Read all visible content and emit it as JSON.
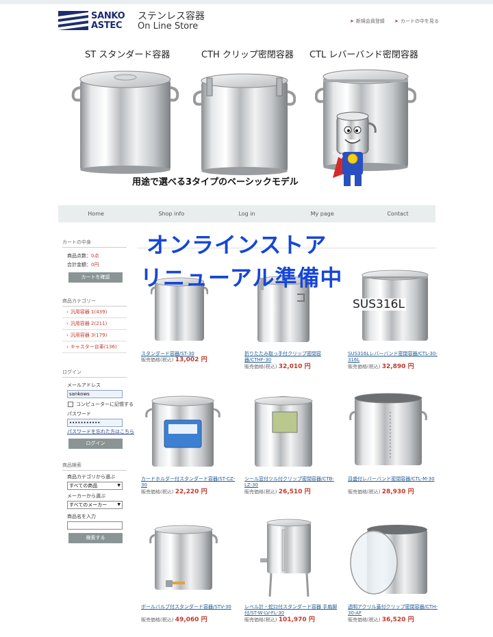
{
  "header": {
    "logo_line1": "SANKO",
    "logo_line2": "ASTEC",
    "logo_line3": "ステンレス容器",
    "logo_line4": "On Line Store",
    "register_link": "新規会員登録",
    "cart_link": "カートの中を見る"
  },
  "banner": {
    "caption_st": "ST スタンダード容器",
    "caption_cth": "CTH クリップ密閉容器",
    "caption_ctl": "CTL レバーバンド密閉容器",
    "tagline": "用途で選べる3タイプのベーシックモデル"
  },
  "nav": [
    "Home",
    "Shop info",
    "Log in",
    "My page",
    "Contact"
  ],
  "overlay": {
    "line1": "オンラインストア",
    "line2": "リニューアル準備中"
  },
  "sidebar": {
    "cart": {
      "heading": "カートの中身",
      "count_label": "商品点数：",
      "count_value": "0点",
      "total_label": "合計金額：",
      "total_value": "0円",
      "confirm_button": "カートを確認"
    },
    "categories": {
      "heading": "商品カテゴリー",
      "items": [
        "汎用容器 1(439)",
        "汎用容器 2(211)",
        "汎用容器 3(179)",
        "キャスター台車(136)"
      ]
    },
    "login": {
      "heading": "ログイン",
      "email_label": "メールアドレス",
      "email_value": "sankows",
      "remember_label": "コンピューターに記憶する",
      "password_label": "パスワード",
      "password_value": "•••••••••••",
      "forgot_link": "パスワードを忘れた方はこちら",
      "login_button": "ログイン"
    },
    "search": {
      "heading": "商品検索",
      "category_label": "商品カテゴリから選ぶ",
      "category_value": "すべての商品",
      "maker_label": "メーカーから選ぶ",
      "maker_value": "すべてのメーカー",
      "name_label": "商品名を入力",
      "search_button": "検索する"
    }
  },
  "products": [
    {
      "name": "スタンダード容器/ST-30",
      "price_label": "販売価格(税込)",
      "price": "13,002 円"
    },
    {
      "name": "折りたたみ取っ手付クリップ密閉容器/CTHF-30",
      "price_label": "販売価格(税込)",
      "price": "32,010 円"
    },
    {
      "name": "SUS316Lレバーバンド密閉容器/CTL-30-316L",
      "price_label": "販売価格(税込)",
      "price": "32,890 円",
      "image_label": "SUS316L"
    },
    {
      "name": "カードホルダー付スタンダード容器/ST-CZ-30",
      "price_label": "販売価格(税込)",
      "price": "22,220 円"
    },
    {
      "name": "シール窓付ツル付クリップ密閉容器/CTB-LZ-30",
      "price_label": "販売価格(税込)",
      "price": "26,510 円"
    },
    {
      "name": "目盛付レバーバンド密閉容器/CTL-M-30",
      "price_label": "販売価格(税込)",
      "price": "28,930 円"
    },
    {
      "name": "ボールバルブ付スタンダード容器/STV-30",
      "price_label": "販売価格(税込)",
      "price": "49,060 円"
    },
    {
      "name": "レベル計・蛇口付スタンダード容器 手扇脚付/ST-W-LV-FL-30",
      "price_label": "販売価格(税込)",
      "price": "101,970 円"
    },
    {
      "name": "透明アクリル蓋付クリップ密閉容器/CTH-30-AF",
      "price_label": "販売価格(税込)",
      "price": "36,520 円"
    }
  ]
}
